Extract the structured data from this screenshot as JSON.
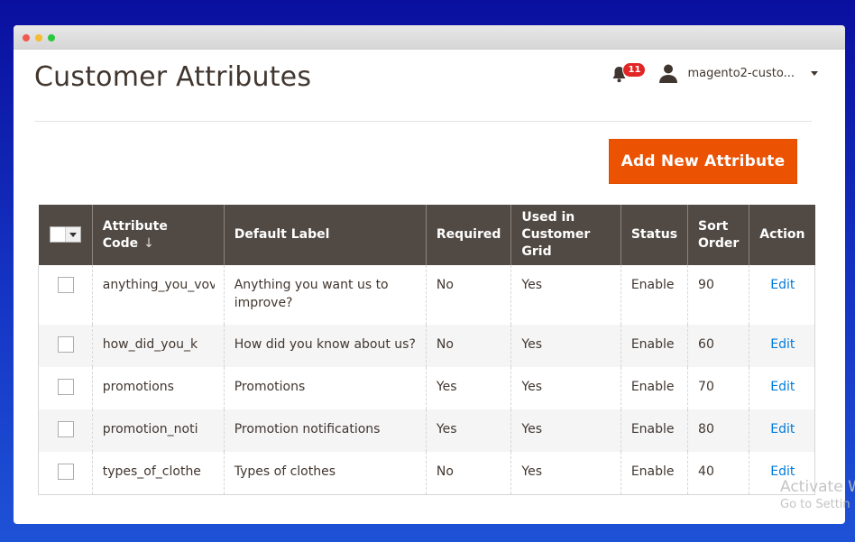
{
  "window": {
    "controls": [
      "close",
      "minimize",
      "maximize"
    ]
  },
  "header": {
    "title": "Customer Attributes",
    "notifications": {
      "icon": "bell-icon",
      "count": "11"
    },
    "user": {
      "icon": "user-icon",
      "name": "magento2-custo..."
    }
  },
  "actions": {
    "add_label": "Add New Attribute"
  },
  "grid": {
    "columns": [
      "",
      "Attribute Code",
      "Default Label",
      "Required",
      "Used in Customer Grid",
      "Status",
      "Sort Order",
      "Action"
    ],
    "sort_indicator": "↓",
    "rows": [
      {
        "code": "anything_you_vov",
        "label": "Anything you want us to improve?",
        "required": "No",
        "in_grid": "Yes",
        "status": "Enable",
        "sort": "90",
        "action": "Edit"
      },
      {
        "code": "how_did_you_k",
        "label": "How did you know about us?",
        "required": "No",
        "in_grid": "Yes",
        "status": "Enable",
        "sort": "60",
        "action": "Edit"
      },
      {
        "code": "promotions",
        "label": "Promotions",
        "required": "Yes",
        "in_grid": "Yes",
        "status": "Enable",
        "sort": "70",
        "action": "Edit"
      },
      {
        "code": "promotion_noti",
        "label": "Promotion notifications",
        "required": "Yes",
        "in_grid": "Yes",
        "status": "Enable",
        "sort": "80",
        "action": "Edit"
      },
      {
        "code": "types_of_clothe",
        "label": "Types of clothes",
        "required": "No",
        "in_grid": "Yes",
        "status": "Enable",
        "sort": "40",
        "action": "Edit"
      }
    ]
  },
  "watermark": {
    "line1": "Activate W",
    "line2": "Go to Settin"
  },
  "colors": {
    "accent": "#eb5202",
    "header_bg": "#514943",
    "link": "#007bdb",
    "badge": "#e22626"
  }
}
